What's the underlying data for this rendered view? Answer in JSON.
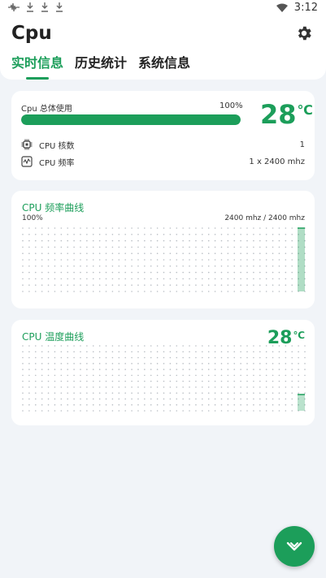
{
  "status_bar": {
    "time": "3:12"
  },
  "header": {
    "title": "Cpu",
    "tabs": [
      {
        "label": "实时信息",
        "active": true
      },
      {
        "label": "历史统计",
        "active": false
      },
      {
        "label": "系统信息",
        "active": false
      }
    ]
  },
  "usage_card": {
    "label": "Cpu 总体使用",
    "percent_text": "100%",
    "progress": 1.0,
    "temperature": "28",
    "temp_unit": "℃",
    "rows": [
      {
        "label": "CPU 核数",
        "value": "1",
        "icon": "cpu-chip-icon"
      },
      {
        "label": "CPU 频率",
        "value": "1 x 2400 mhz",
        "icon": "frequency-icon"
      }
    ]
  },
  "freq_card": {
    "title": "CPU 频率曲线",
    "left_label": "100%",
    "right_label": "2400 mhz / 2400 mhz"
  },
  "temp_card": {
    "title": "CPU 温度曲线",
    "temperature": "28",
    "temp_unit": "℃"
  },
  "colors": {
    "accent": "#1c9e5a",
    "background": "#f1f4f8",
    "card": "#ffffff"
  },
  "fab": {
    "icon": "chevron-down-icon"
  }
}
